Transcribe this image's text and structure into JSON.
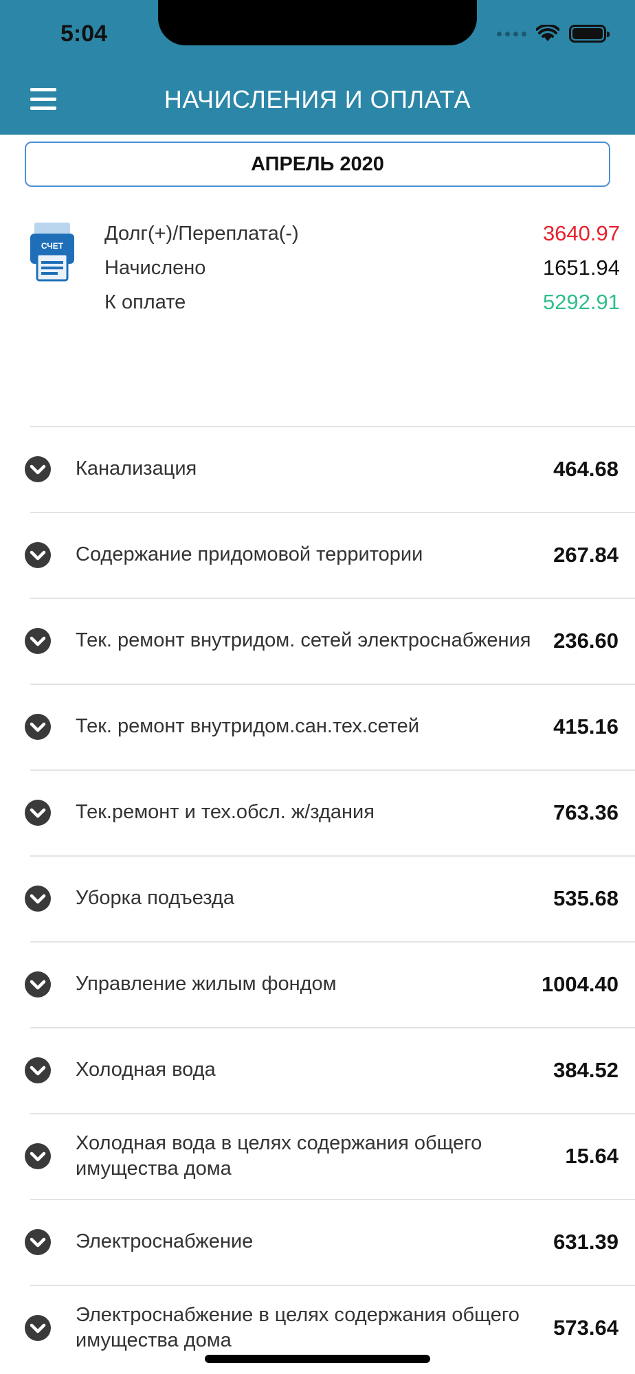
{
  "status_bar": {
    "time": "5:04"
  },
  "header": {
    "title": "НАЧИСЛЕНИЯ И ОПЛАТА"
  },
  "month": {
    "label": "АПРЕЛЬ 2020"
  },
  "summary": {
    "icon_label": "СЧЕТ",
    "rows": [
      {
        "label": "Долг(+)/Переплата(-)",
        "value": "3640.97"
      },
      {
        "label": "Начислено",
        "value": "1651.94"
      },
      {
        "label": "К оплате",
        "value": "5292.91"
      }
    ]
  },
  "colors": {
    "header": "#2c86a7",
    "debt": "#e8212f",
    "to_pay": "#2fbf8a",
    "month_border": "#4a90d9"
  },
  "items": [
    {
      "label": "Канализация",
      "value": "464.68"
    },
    {
      "label": "Содержание придомовой территории",
      "value": "267.84"
    },
    {
      "label": "Тек. ремонт внутридом. сетей электроснабжения",
      "value": "236.60"
    },
    {
      "label": "Тек. ремонт внутридом.сан.тех.сетей",
      "value": "415.16"
    },
    {
      "label": "Тек.ремонт и тех.обсл. ж/здания",
      "value": "763.36"
    },
    {
      "label": "Уборка подъезда",
      "value": "535.68"
    },
    {
      "label": "Управление жилым фондом",
      "value": "1004.40"
    },
    {
      "label": "Холодная вода",
      "value": "384.52"
    },
    {
      "label": "Холодная вода в целях содержания общего имущества дома",
      "value": "15.64"
    },
    {
      "label": "Электроснабжение",
      "value": "631.39"
    },
    {
      "label": "Электроснабжение в целях содержания общего имущества дома",
      "value": "573.64"
    }
  ]
}
